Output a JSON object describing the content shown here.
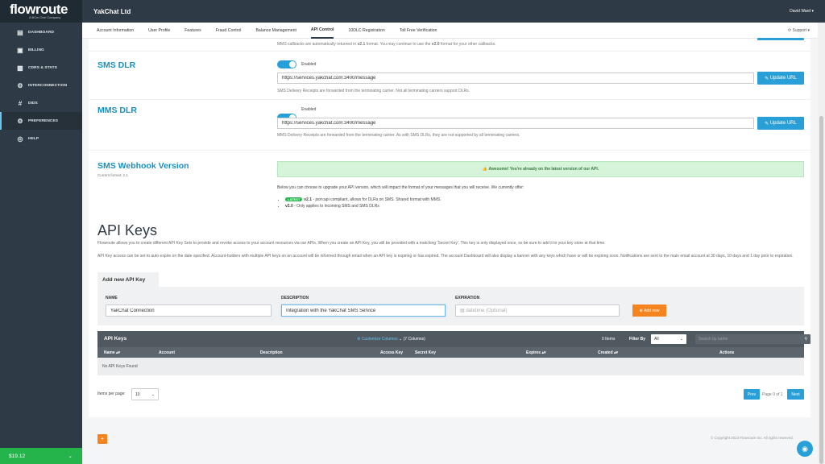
{
  "brand": {
    "logo": "flowroute",
    "tagline": "A BCm One Company"
  },
  "sidebar": {
    "items": [
      {
        "label": "DASHBOARD",
        "icon": "dashboard-icon"
      },
      {
        "label": "BILLING",
        "icon": "billing-icon"
      },
      {
        "label": "CDRS & STATS",
        "icon": "chart-icon"
      },
      {
        "label": "INTERCONNECTION",
        "icon": "gears-icon"
      },
      {
        "label": "DIDS",
        "icon": "hash-icon"
      },
      {
        "label": "PREFERENCES",
        "icon": "gear-icon"
      },
      {
        "label": "HELP",
        "icon": "help-icon"
      }
    ],
    "active": "PREFERENCES",
    "balance": "$19.12"
  },
  "topbar": {
    "company": "YakChat Ltd",
    "user": "David Ward"
  },
  "subnav": {
    "tabs": [
      "Account Information",
      "User Profile",
      "Features",
      "Fraud Control",
      "Balance Management",
      "API Control",
      "10DLC Registration",
      "Toll Free Verification"
    ],
    "active": "API Control",
    "support": "Support"
  },
  "callbacks": {
    "note_pre": "MMS callbacks are automatically returned in ",
    "note_v1": "v2.1",
    "note_mid": " format. You may continue to use the ",
    "note_v2": "v2.0",
    "note_post": " format for your other callbacks."
  },
  "sms_dlr": {
    "title": "SMS DLR",
    "toggle_label": "Enabled",
    "url": "https://services.yakchat.com:3400/message",
    "button": "Update URL",
    "note": "SMS Delivery Receipts are forwarded from the terminating carrier. Not all terminating carriers support DLRs."
  },
  "mms_dlr": {
    "title": "MMS DLR",
    "toggle_label": "Enabled",
    "url": "https://services.yakchat.com:3400/message",
    "button": "Update URL",
    "note": "MMS Delivery Receipts are forwarded from the terminating carrier. As with SMS DLRs, they are not supported by all terminating carriers."
  },
  "webhook": {
    "title": "SMS Webhook Version",
    "current": "Current format: 2.1",
    "success": "Awesome! You're already on the latest version of our API.",
    "intro": "Below you can choose to upgrade your API version, which will impact the format of your messages that you will receive. We currently offer:",
    "latest_badge": "LATEST",
    "v21_version": "v2.1",
    "v21_desc": " - json:api compliant, allows for DLRs on SMS. Shared format with MMS.",
    "v20_version": "v2.0",
    "v20_desc": " - Only applies to incoming SMS and SMS DLRs"
  },
  "api_keys": {
    "title": "API Keys",
    "para1": "Flowroute allows you to create different API Key Sets to provide and revoke access to your account resources via our APIs. When you create an API Key, you will be provided with a matching 'Secret Key'. This key is only displayed once, so be sure to add it to your key store at that time.",
    "para2": "API Key access can be set to auto expire on the date specified. Account-holders with multiple API keys on an account will be informed through email when an API key is expiring or has expired. The account Dashboard will also display a banner with any keys which have or will be expiring soon. Notifications are sent to the main email account at 30 days, 10 days and 1 day prior to expiration.",
    "form_tab": "Add new API Key",
    "name_label": "NAME",
    "name_value": "YakChat Connection",
    "desc_label": "DESCRIPTION",
    "desc_value": "Integration with the YakChat SMS Service",
    "exp_label": "EXPIRATION",
    "exp_placeholder": "datetime (Optional)",
    "add_button": "Add new"
  },
  "table": {
    "title": "API Keys",
    "customize": "Customize Columns",
    "columns_count": "(7 Columns)",
    "items": "0 Items",
    "filter_label": "Filter By",
    "filter_value": "All",
    "search_placeholder": "Search by name",
    "headers": [
      "Name",
      "Account",
      "Description",
      "Access Key",
      "Secret Key",
      "Expires",
      "Created",
      "Actions"
    ],
    "empty": "No API Keys Found",
    "per_page_label": "Items per page:",
    "per_page_value": "10",
    "prev": "Prev",
    "page_info": "Page 0 of 1",
    "next": "Next"
  },
  "footer": {
    "copyright": "© Copyright 2023 Flowroute Inc. All rights reserved."
  },
  "colors": {
    "sidebar": "#2e3a45",
    "accent": "#28a0d7",
    "success": "#25b34b",
    "orange": "#f5841f",
    "title": "#1a8fbf"
  }
}
